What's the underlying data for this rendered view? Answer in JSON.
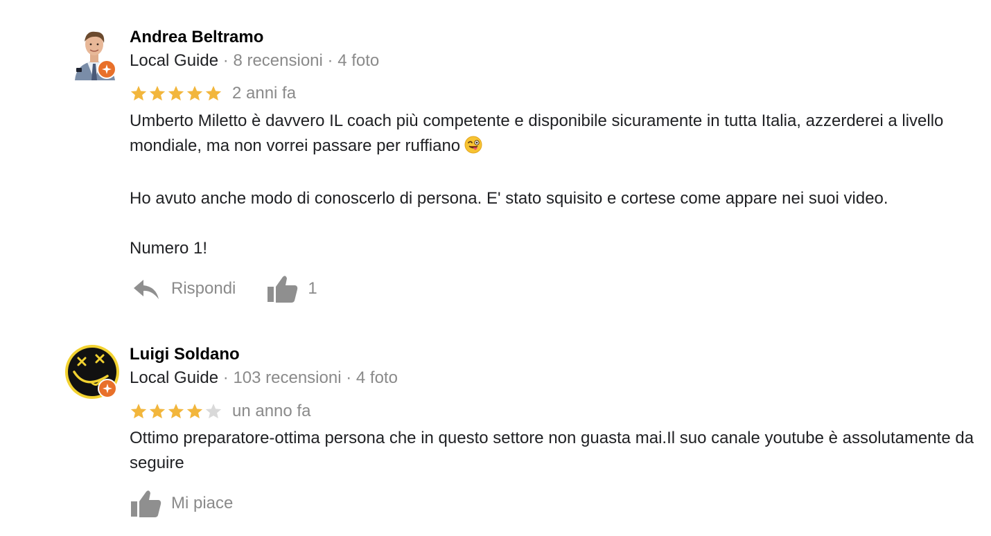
{
  "reviews": [
    {
      "author": "Andrea Beltramo",
      "badge_label": "Local Guide",
      "meta_sep": "·",
      "reviews_count": "8 recensioni",
      "photos_count": "4 foto",
      "rating": 5,
      "max_rating": 5,
      "time": "2 anni fa",
      "paragraphs": [
        "Umberto Miletto è davvero IL coach più competente e disponibile sicuramente in tutta Italia, azzerderei a livello mondiale, ma non vorrei passare per ruffiano",
        "Ho avuto anche modo di conoscerlo di persona. E' stato squisito e cortese come appare nei suoi video.",
        "Numero 1!"
      ],
      "reply_label": "Rispondi",
      "like_count": "1"
    },
    {
      "author": "Luigi Soldano",
      "badge_label": "Local Guide",
      "meta_sep": "·",
      "reviews_count": "103 recensioni",
      "photos_count": "4 foto",
      "rating": 4,
      "max_rating": 5,
      "time": "un anno fa",
      "paragraphs": [
        "Ottimo preparatore-ottima persona che in questo settore non guasta mai.Il suo canale youtube è assolutamente da seguire"
      ],
      "like_label": "Mi piace"
    }
  ],
  "colors": {
    "star_filled": "#f2b63c",
    "star_empty": "#d9d9d9",
    "badge": "#e8702a",
    "muted_text": "#8a8a8a",
    "icon_grey": "#8f8f8f"
  },
  "icons": [
    "avatar-andrea",
    "avatar-luigi",
    "local-guide-badge-icon",
    "star-icon",
    "wink-tongue-emoji-icon",
    "reply-arrow-icon",
    "thumbs-up-icon"
  ]
}
